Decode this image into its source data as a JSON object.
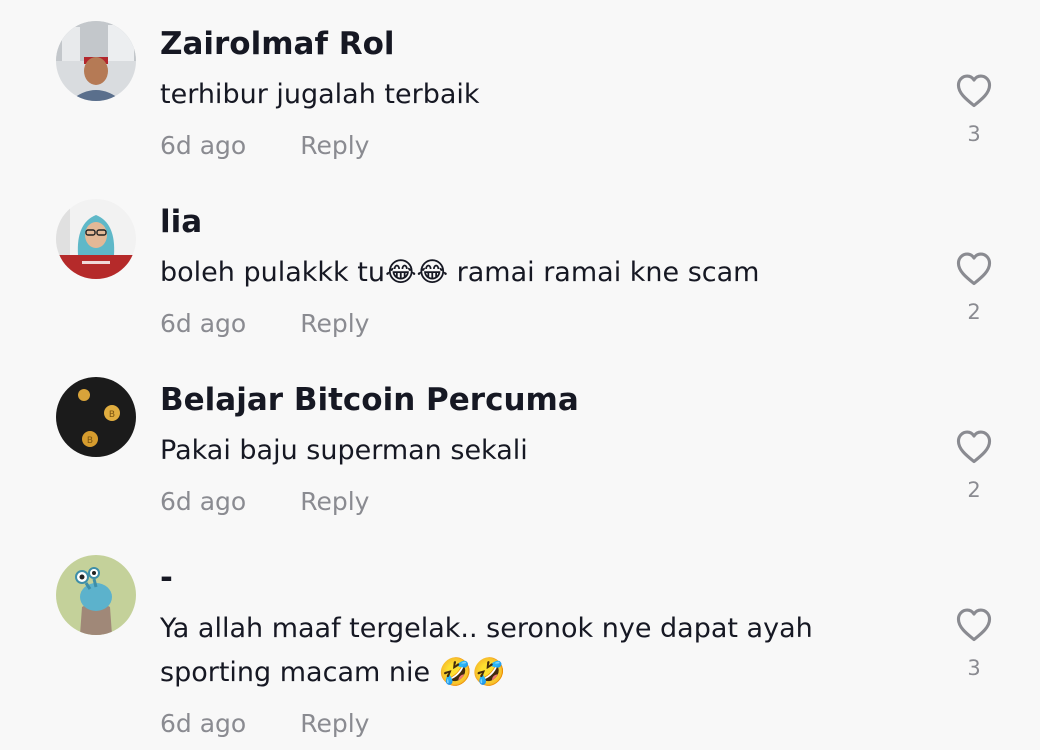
{
  "comments": [
    {
      "username": "Zairolmaf Rol",
      "text": "terhibur jugalah terbaik",
      "time": "6d ago",
      "reply_label": "Reply",
      "likes": "3",
      "avatar_icon": "person-photo"
    },
    {
      "username": "lia",
      "text": "boleh pulakkk tu😂😂 ramai ramai kne scam",
      "time": "6d ago",
      "reply_label": "Reply",
      "likes": "2",
      "avatar_icon": "person-hijab-photo"
    },
    {
      "username": "Belajar Bitcoin Percuma",
      "text": "Pakai baju superman sekali",
      "time": "6d ago",
      "reply_label": "Reply",
      "likes": "2",
      "avatar_icon": "bitcoin-coins-photo"
    },
    {
      "username": "-",
      "text": "Ya allah maaf tergelak.. seronok nye dapat ayah sporting macam nie 🤣🤣",
      "time": "6d ago",
      "reply_label": "Reply",
      "likes": "3",
      "avatar_icon": "default-cartoon-avatar"
    }
  ],
  "colors": {
    "background": "#f8f8f8",
    "username": "#161823",
    "meta": "#8a8b91",
    "like_icon": "#8a8b91"
  }
}
